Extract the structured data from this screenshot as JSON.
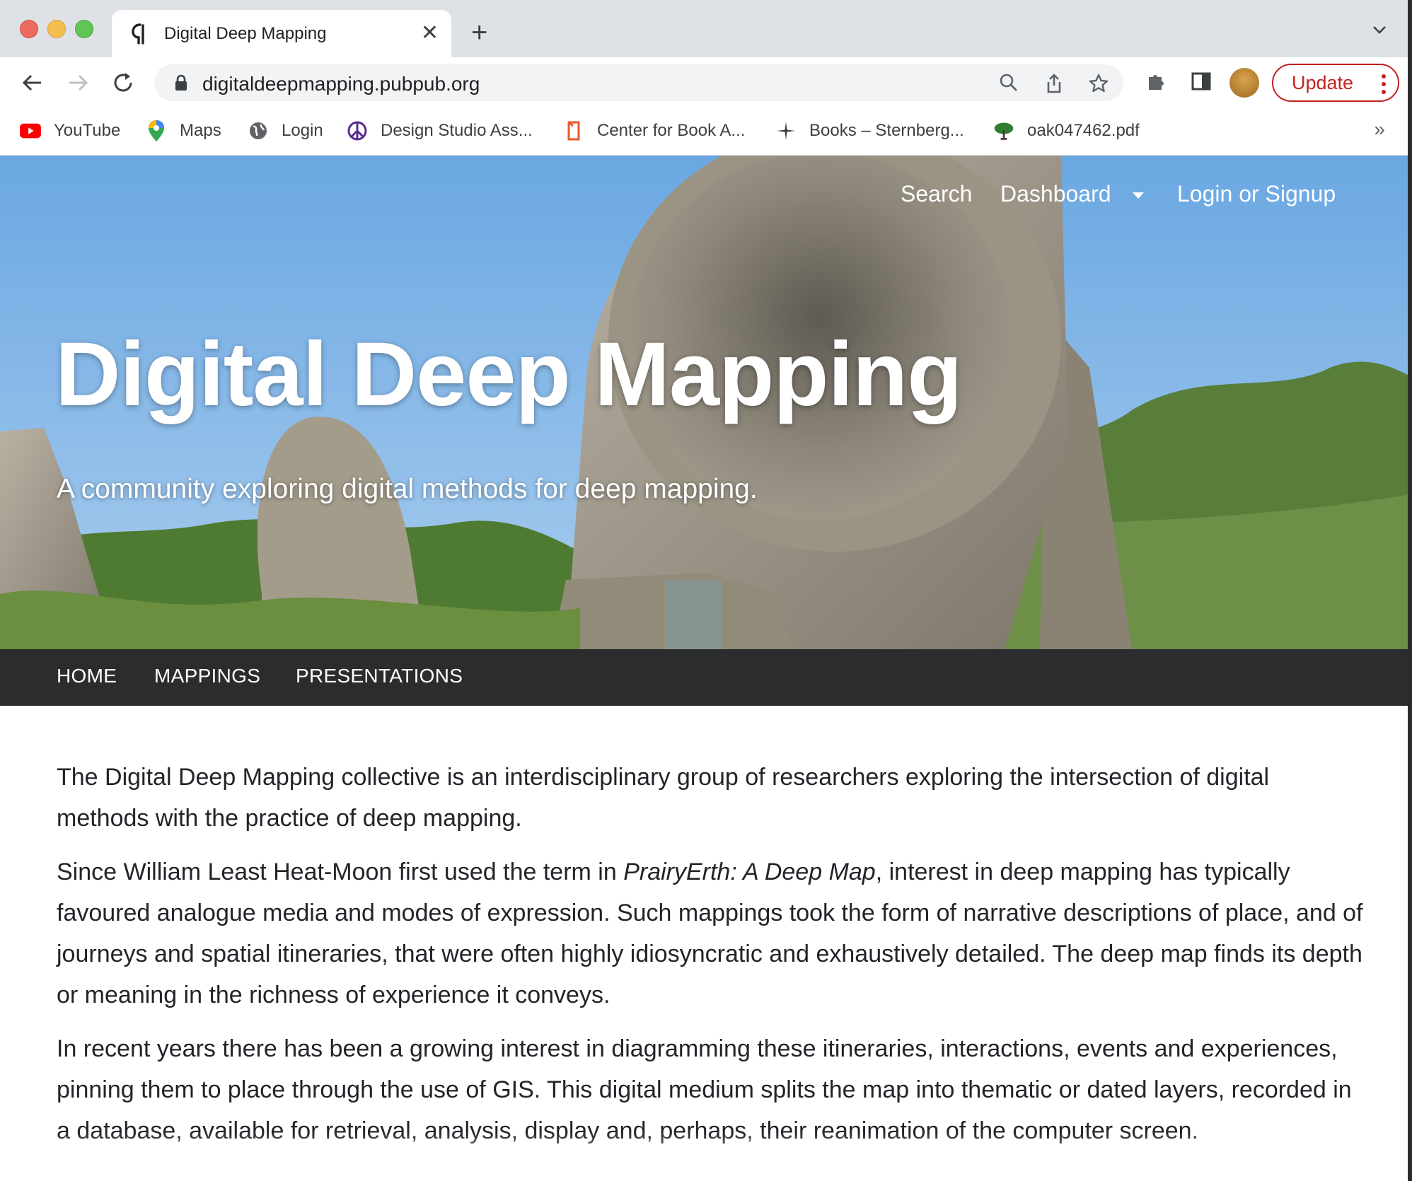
{
  "browser": {
    "tab": {
      "title": "Digital Deep Mapping"
    },
    "address": {
      "url": "digitaldeepmapping.pubpub.org"
    },
    "update_label": "Update",
    "bookmarks": [
      {
        "label": "YouTube",
        "icon": "youtube-icon"
      },
      {
        "label": "Maps",
        "icon": "maps-pin-icon"
      },
      {
        "label": "Login",
        "icon": "globe-icon"
      },
      {
        "label": "Design Studio Ass...",
        "icon": "peace-icon"
      },
      {
        "label": "Center for Book A...",
        "icon": "book-logo-icon"
      },
      {
        "label": "Books – Sternberg...",
        "icon": "star-logo-icon"
      },
      {
        "label": "oak047462.pdf",
        "icon": "tree-icon"
      }
    ],
    "bookmarks_more": "»"
  },
  "site": {
    "nav": {
      "search": "Search",
      "dashboard": "Dashboard",
      "login": "Login or Signup"
    },
    "title": "Digital Deep Mapping",
    "subtitle": "A community exploring digital methods for deep mapping.",
    "menu": [
      "HOME",
      "MAPPINGS",
      "PRESENTATIONS"
    ]
  },
  "content": {
    "p1": "The Digital Deep Mapping collective is an interdisciplinary group of researchers exploring the intersection of digital methods with the practice of deep mapping.",
    "p2_before": "Since William Least Heat-Moon first used the term in ",
    "p2_em": "PrairyErth: A Deep Map",
    "p2_after": ", interest in deep mapping has typically favoured analogue media and modes of expression. Such mappings took the form of narrative descriptions of place, and of journeys and spatial itineraries, that were often highly idiosyncratic and exhaustively detailed. The deep map finds its depth or meaning in the richness of experience it conveys.",
    "p3": "In recent years there has been a growing interest in diagramming these itineraries, interactions, events and experiences, pinning them to place through the use of GIS. This digital medium splits the map into thematic or dated layers, recorded in a database, available for retrieval, analysis, display and, perhaps, their reanimation of the computer screen."
  },
  "colors": {
    "update_red": "#c5221f",
    "menu_bar": "#2b2c2e",
    "sky": "#7fb6e8"
  }
}
